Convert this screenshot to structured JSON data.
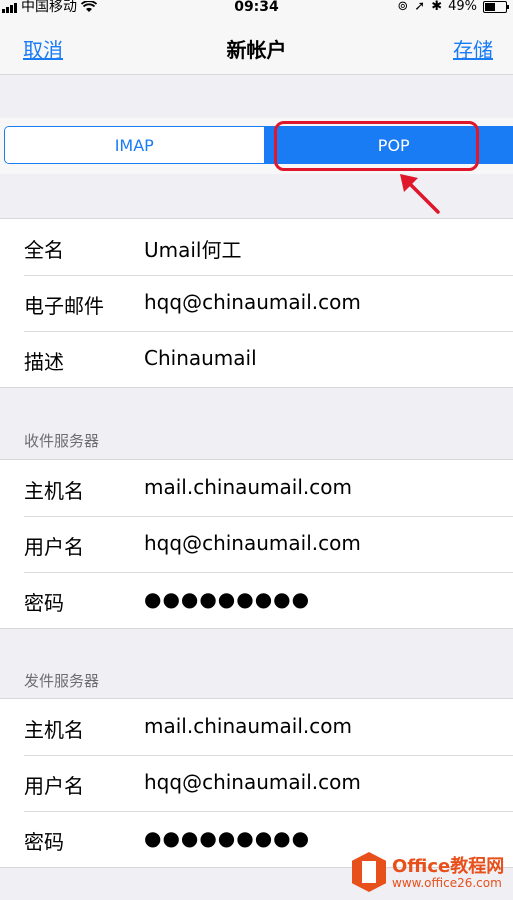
{
  "status_bar": {
    "carrier": "中国移动",
    "time": "09:34",
    "battery": "49%",
    "battery_level": 0.49
  },
  "nav": {
    "cancel": "取消",
    "title": "新帐户",
    "save": "存储"
  },
  "segmented": {
    "options": [
      "IMAP",
      "POP"
    ],
    "selected": "POP"
  },
  "account": {
    "rows": [
      {
        "label": "全名",
        "value": "Umail何工"
      },
      {
        "label": "电子邮件",
        "value": "hqq@chinaumail.com"
      },
      {
        "label": "描述",
        "value": "Chinaumail"
      }
    ]
  },
  "incoming": {
    "header": "收件服务器",
    "rows": [
      {
        "label": "主机名",
        "value": "mail.chinaumail.com"
      },
      {
        "label": "用户名",
        "value": "hqq@chinaumail.com"
      },
      {
        "label": "密码",
        "value": "●●●●●●●●●"
      }
    ]
  },
  "outgoing": {
    "header": "发件服务器",
    "rows": [
      {
        "label": "主机名",
        "value": "mail.chinaumail.com"
      },
      {
        "label": "用户名",
        "value": "hqq@chinaumail.com"
      },
      {
        "label": "密码",
        "value": "●●●●●●●●●"
      }
    ]
  },
  "watermark": {
    "brand": "Office教程网",
    "url": "www.office26.com"
  },
  "colors": {
    "accent": "#1a7cf5",
    "highlight": "#e0162b",
    "watermark": "#e8501b"
  }
}
